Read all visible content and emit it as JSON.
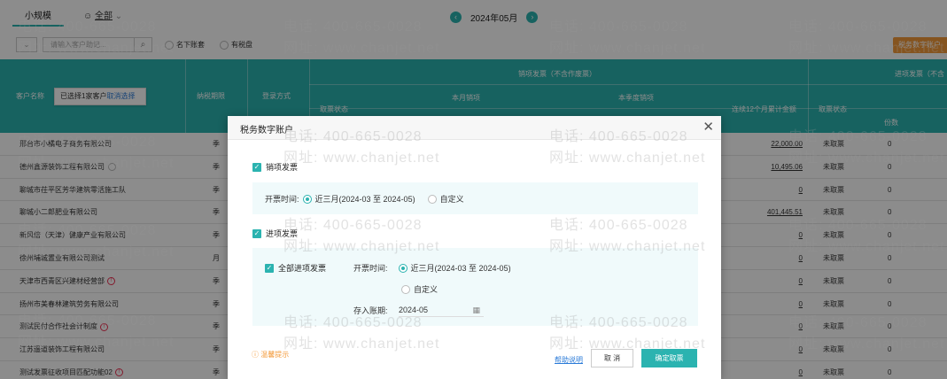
{
  "topbar": {
    "tab_small": "小规模",
    "tab_all": "全部",
    "month": "2024年05月",
    "search_placeholder": "请输入客户助记...",
    "opt1": "名下账套",
    "opt2": "有税盘",
    "orange_button": "税务数字账户"
  },
  "table": {
    "col_customer": "客户名称",
    "col_period": "纳税期限",
    "col_login": "登录方式",
    "group_sales": "销项发票（不含作废票）",
    "group_input": "进项发票（不含",
    "col_bill_status": "取票状态",
    "col_month_sales": "本月销项",
    "col_quarter_sales": "本季度销项",
    "col_12month": "连续12个月累计金额",
    "col_bill_status2": "取票状态",
    "col_count": "份数",
    "rows": [
      {
        "name": "邢台市小橘电子商务有限公司",
        "period": "季",
        "amount": "22,000.00",
        "status": "未取票",
        "count": "0",
        "mark": ""
      },
      {
        "name": "德州鑫源装饰工程有限公司",
        "period": "季",
        "amount": "10,495.06",
        "status": "未取票",
        "count": "0",
        "mark": "ok"
      },
      {
        "name": "聊城市茌平区芳华建筑零活施工队",
        "period": "季",
        "amount": "0",
        "status": "未取票",
        "count": "0",
        "mark": ""
      },
      {
        "name": "聊城小二郎肥业有限公司",
        "period": "季",
        "amount": "401,445.51",
        "status": "未取票",
        "count": "0",
        "mark": ""
      },
      {
        "name": "新风倍（天津）健康产业有限公司",
        "period": "季",
        "amount": "0",
        "status": "未取票",
        "count": "0",
        "mark": ""
      },
      {
        "name": "徐州埔城置业有限公司测试",
        "period": "月",
        "amount": "0",
        "status": "未取票",
        "count": "0",
        "mark": ""
      },
      {
        "name": "天津市西青区兴建材经营部",
        "period": "季",
        "amount": "0",
        "status": "未取票",
        "count": "0",
        "mark": "warn"
      },
      {
        "name": "扬州市美春林建筑劳务有限公司",
        "period": "季",
        "amount": "0",
        "status": "未取票",
        "count": "0",
        "mark": ""
      },
      {
        "name": "测试民付合作社会计制度",
        "period": "季",
        "amount": "0",
        "status": "未取票",
        "count": "0",
        "mark": "warn"
      },
      {
        "name": "江苏遥道装饰工程有限公司",
        "period": "季",
        "amount": "0",
        "status": "未取票",
        "count": "0",
        "mark": ""
      },
      {
        "name": "测试发票征收项目匹配功能02",
        "period": "季",
        "amount": "0",
        "status": "未取票",
        "count": "0",
        "mark": "warn"
      }
    ]
  },
  "tooltip": {
    "selected": "已选择1家客户",
    "cancel": "取消选择"
  },
  "modal": {
    "title": "税务数字账户",
    "close": "✕",
    "sales_label": "销项发票",
    "open_time_label": "开票时间:",
    "recent3": "近三月(2024-03 至 2024-05)",
    "custom": "自定义",
    "input_label": "进项发票",
    "all_input": "全部进项发票",
    "open_time_label2": "开票时间:",
    "recent3_b": "近三月(2024-03 至 2024-05)",
    "custom_b": "自定义",
    "account_period_label": "存入账期:",
    "account_period_value": "2024-05",
    "tip": "温馨提示",
    "help": "帮助说明",
    "cancel": "取 消",
    "confirm": "确定取票"
  },
  "watermark": {
    "phone": "电话: 400-665-0028",
    "site": "网址: www.chanjet.net"
  },
  "colors": {
    "accent": "#2bb3b0",
    "orange": "#f39a3a",
    "link": "#2b7bd8",
    "warn": "#e35"
  }
}
